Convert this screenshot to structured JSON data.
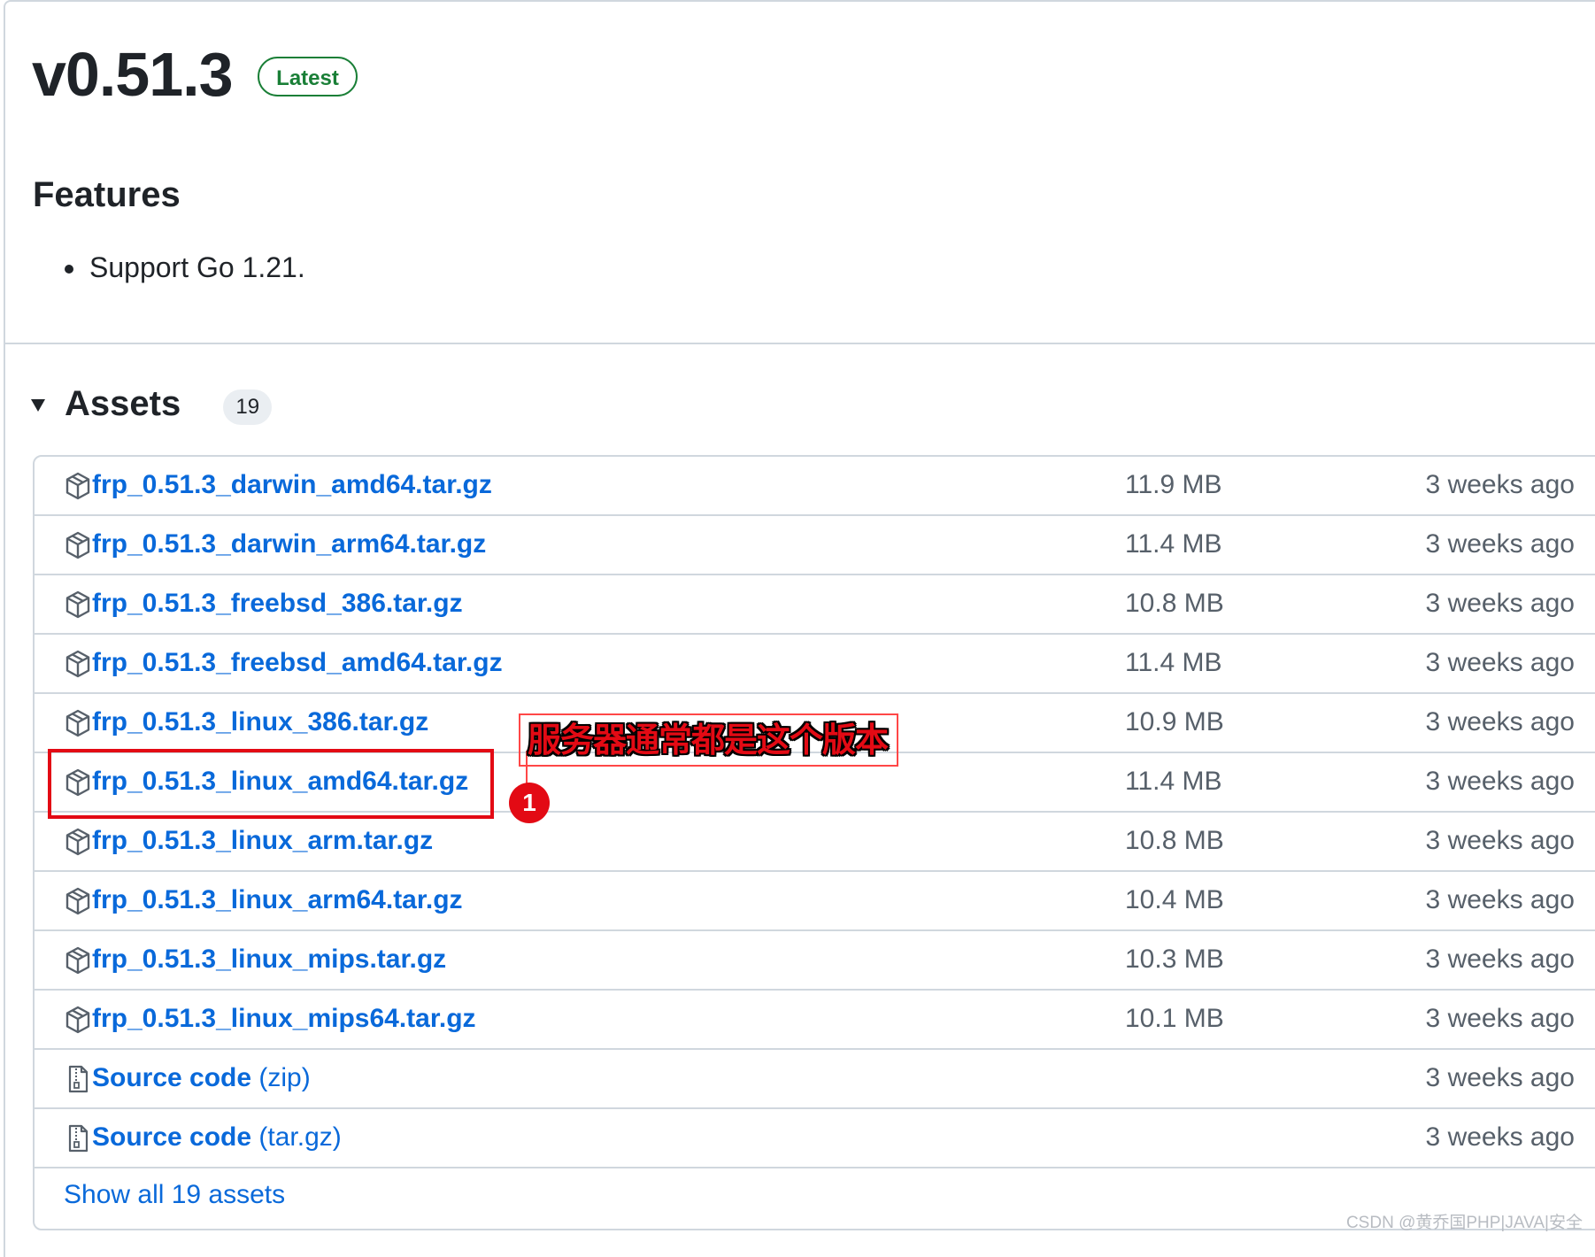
{
  "release": {
    "title": "v0.51.3",
    "badge": "Latest"
  },
  "features": {
    "heading": "Features",
    "items": [
      "Support Go 1.21."
    ]
  },
  "assets": {
    "heading": "Assets",
    "count": "19",
    "show_all": "Show all 19 assets",
    "files": [
      {
        "name": "frp_0.51.3_darwin_amd64.tar.gz",
        "size": "11.9 MB",
        "date": "3 weeks ago",
        "icon": "package-icon"
      },
      {
        "name": "frp_0.51.3_darwin_arm64.tar.gz",
        "size": "11.4 MB",
        "date": "3 weeks ago",
        "icon": "package-icon"
      },
      {
        "name": "frp_0.51.3_freebsd_386.tar.gz",
        "size": "10.8 MB",
        "date": "3 weeks ago",
        "icon": "package-icon"
      },
      {
        "name": "frp_0.51.3_freebsd_amd64.tar.gz",
        "size": "11.4 MB",
        "date": "3 weeks ago",
        "icon": "package-icon"
      },
      {
        "name": "frp_0.51.3_linux_386.tar.gz",
        "size": "10.9 MB",
        "date": "3 weeks ago",
        "icon": "package-icon"
      },
      {
        "name": "frp_0.51.3_linux_amd64.tar.gz",
        "size": "11.4 MB",
        "date": "3 weeks ago",
        "icon": "package-icon"
      },
      {
        "name": "frp_0.51.3_linux_arm.tar.gz",
        "size": "10.8 MB",
        "date": "3 weeks ago",
        "icon": "package-icon"
      },
      {
        "name": "frp_0.51.3_linux_arm64.tar.gz",
        "size": "10.4 MB",
        "date": "3 weeks ago",
        "icon": "package-icon"
      },
      {
        "name": "frp_0.51.3_linux_mips.tar.gz",
        "size": "10.3 MB",
        "date": "3 weeks ago",
        "icon": "package-icon"
      },
      {
        "name": "frp_0.51.3_linux_mips64.tar.gz",
        "size": "10.1 MB",
        "date": "3 weeks ago",
        "icon": "package-icon"
      }
    ],
    "source_files": [
      {
        "name": "Source code",
        "suffix": "(zip)",
        "date": "3 weeks ago",
        "icon": "file-zip-icon"
      },
      {
        "name": "Source code",
        "suffix": "(tar.gz)",
        "date": "3 weeks ago",
        "icon": "file-zip-icon"
      }
    ]
  },
  "annotation": {
    "text": "服务器通常都是这个版本",
    "marker": "1",
    "color": "#e30a14"
  },
  "watermark": "CSDN @黄乔国PHP|JAVA|安全",
  "colors": {
    "link": "#0969da",
    "latest": "#1a7f37",
    "border": "#d0d7de",
    "muted": "#57606a"
  }
}
